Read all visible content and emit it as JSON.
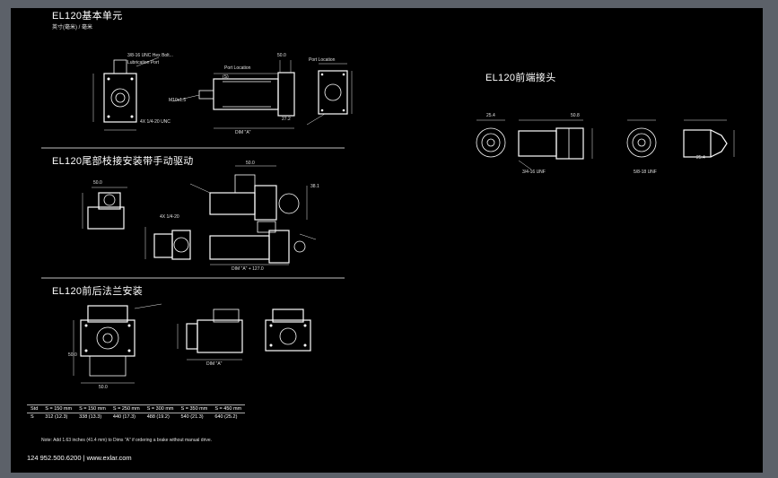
{
  "sections": {
    "basic_unit": {
      "title": "EL120基本单元",
      "subtitle": "英寸(毫米) / 毫米"
    },
    "motor_mount": {
      "title": "EL120尾部枝接安装带手动驱动"
    },
    "flange": {
      "title": "EL120前后法兰安装"
    },
    "front_ends": {
      "title": "EL120前端接头"
    }
  },
  "dims": {
    "bu_note1": "3/8-16 UNC Hex Bolt...",
    "bu_note2": "Lubrication Port",
    "bu_pl1": "Port Location",
    "bu_pl2": "Port Location",
    "bu_a": "(S)",
    "bu_b": "50.0",
    "bu_c": "27.2",
    "bu_d": "DIM \"A\"",
    "bu_e": "4X 1/4-20 UNC",
    "bu_f": "M10x1.5",
    "mm_a": "50.0",
    "mm_b": "50.0",
    "mm_c": "4X 1/4-20",
    "mm_d": "38.1",
    "mm_e": "DIM \"A\" + 127.0",
    "fl_a": "50.0",
    "fl_b": "50.0",
    "fl_c": "DIM \"A\"",
    "fe_a": "25.4",
    "fe_b": "50.8",
    "fe_c": "3/4-16 UNF",
    "fe_d": "5/8-18 UNF",
    "fe_e": "25.4"
  },
  "table": {
    "header": [
      "Std",
      "S = 150 mm",
      "S = 150 mm",
      "S = 250 mm",
      "S = 300 mm",
      "S = 350 mm",
      "S = 450 mm"
    ],
    "row": [
      "S",
      "312 (12.3)",
      "338 (13.3)",
      "440 (17.3)",
      "488 (19.2)",
      "540 (21.3)",
      "640 (25.2)"
    ]
  },
  "note": "Note: Add 1.63 inches (41.4 mm) to Dims \"A\" if ordering a brake without manual drive.",
  "footer": {
    "page": "124",
    "phone": "952.500.6200",
    "sep": "|",
    "web": "www.exlar.com"
  }
}
